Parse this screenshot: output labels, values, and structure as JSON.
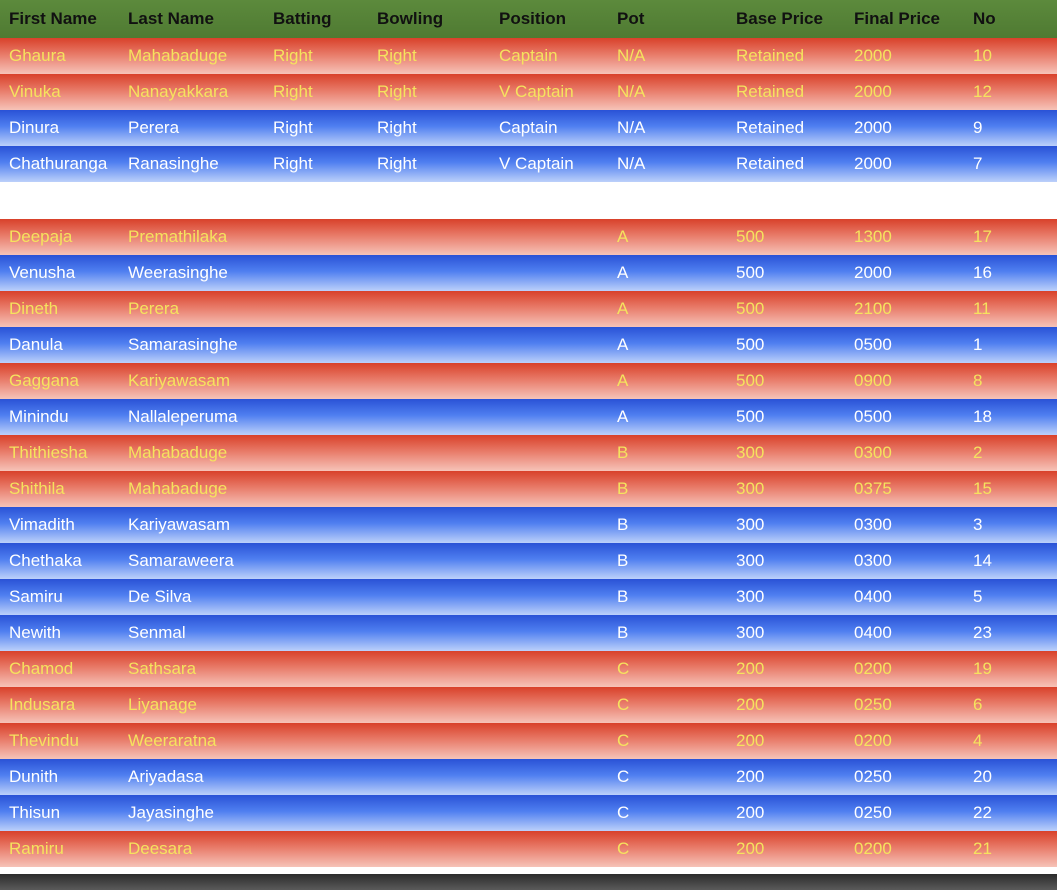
{
  "headers": [
    "First Name",
    "Last Name",
    "Batting",
    "Bowling",
    "Position",
    "Pot",
    "Base Price",
    "Final Price",
    "No"
  ],
  "colors": {
    "header": "#5c8a3c",
    "red_row": "#d8412a",
    "blue_row": "#2a52d6",
    "text_yellow": "#f5e35e"
  },
  "group1": [
    {
      "color": "red",
      "cells": [
        "Ghaura",
        "Mahabaduge",
        "Right",
        "Right",
        "Captain",
        "N/A",
        "Retained",
        "2000",
        "10"
      ]
    },
    {
      "color": "red",
      "cells": [
        "Vinuka",
        "Nanayakkara",
        "Right",
        "Right",
        "V Captain",
        "N/A",
        "Retained",
        "2000",
        "12"
      ]
    },
    {
      "color": "blue",
      "cells": [
        "Dinura",
        "Perera",
        "Right",
        "Right",
        "Captain",
        "N/A",
        "Retained",
        "2000",
        "9"
      ]
    },
    {
      "color": "blue",
      "cells": [
        "Chathuranga",
        "Ranasinghe",
        "Right",
        "Right",
        "V Captain",
        "N/A",
        "Retained",
        "2000",
        "7"
      ]
    }
  ],
  "group2": [
    {
      "color": "red",
      "cells": [
        "Deepaja",
        "Premathilaka",
        "",
        "",
        "",
        "A",
        "500",
        "1300",
        "17"
      ]
    },
    {
      "color": "blue",
      "cells": [
        "Venusha",
        "Weerasinghe",
        "",
        "",
        "",
        "A",
        "500",
        "2000",
        "16"
      ]
    },
    {
      "color": "red",
      "cells": [
        "Dineth",
        "Perera",
        "",
        "",
        "",
        "A",
        "500",
        "2100",
        "11"
      ]
    },
    {
      "color": "blue",
      "cells": [
        "Danula",
        "Samarasinghe",
        "",
        "",
        "",
        "A",
        "500",
        "0500",
        "1"
      ]
    },
    {
      "color": "red",
      "cells": [
        "Gaggana",
        "Kariyawasam",
        "",
        "",
        "",
        "A",
        "500",
        "0900",
        "8"
      ]
    },
    {
      "color": "blue",
      "cells": [
        "Minindu",
        "Nallaleperuma",
        "",
        "",
        "",
        "A",
        "500",
        "0500",
        "18"
      ]
    },
    {
      "color": "red",
      "cells": [
        "Thithiesha",
        "Mahabaduge",
        "",
        "",
        "",
        "B",
        "300",
        "0300",
        "2"
      ]
    },
    {
      "color": "red",
      "cells": [
        "Shithila",
        "Mahabaduge",
        "",
        "",
        "",
        "B",
        "300",
        "0375",
        "15"
      ]
    },
    {
      "color": "blue",
      "cells": [
        "Vimadith",
        "Kariyawasam",
        "",
        "",
        "",
        "B",
        "300",
        "0300",
        "3"
      ]
    },
    {
      "color": "blue",
      "cells": [
        "Chethaka",
        "Samaraweera",
        "",
        "",
        "",
        "B",
        "300",
        "0300",
        "14"
      ]
    },
    {
      "color": "blue",
      "cells": [
        "Samiru",
        "De Silva",
        "",
        "",
        "",
        "B",
        "300",
        "0400",
        "5"
      ]
    },
    {
      "color": "blue",
      "cells": [
        "Newith",
        "Senmal",
        "",
        "",
        "",
        "B",
        "300",
        "0400",
        "23"
      ]
    },
    {
      "color": "red",
      "cells": [
        "Chamod",
        "Sathsara",
        "",
        "",
        "",
        "C",
        "200",
        "0200",
        "19"
      ]
    },
    {
      "color": "red",
      "cells": [
        "Indusara",
        "Liyanage",
        "",
        "",
        "",
        "C",
        "200",
        "0250",
        "6"
      ]
    },
    {
      "color": "red",
      "cells": [
        "Thevindu",
        "Weeraratna",
        "",
        "",
        "",
        "C",
        "200",
        "0200",
        "4"
      ]
    },
    {
      "color": "blue",
      "cells": [
        "Dunith",
        "Ariyadasa",
        "",
        "",
        "",
        "C",
        "200",
        "0250",
        "20"
      ]
    },
    {
      "color": "blue",
      "cells": [
        "Thisun",
        "Jayasinghe",
        "",
        "",
        "",
        "C",
        "200",
        "0250",
        "22"
      ]
    },
    {
      "color": "red",
      "cells": [
        "Ramiru",
        "Deesara",
        "",
        "",
        "",
        "C",
        "200",
        "0200",
        "21"
      ]
    }
  ]
}
